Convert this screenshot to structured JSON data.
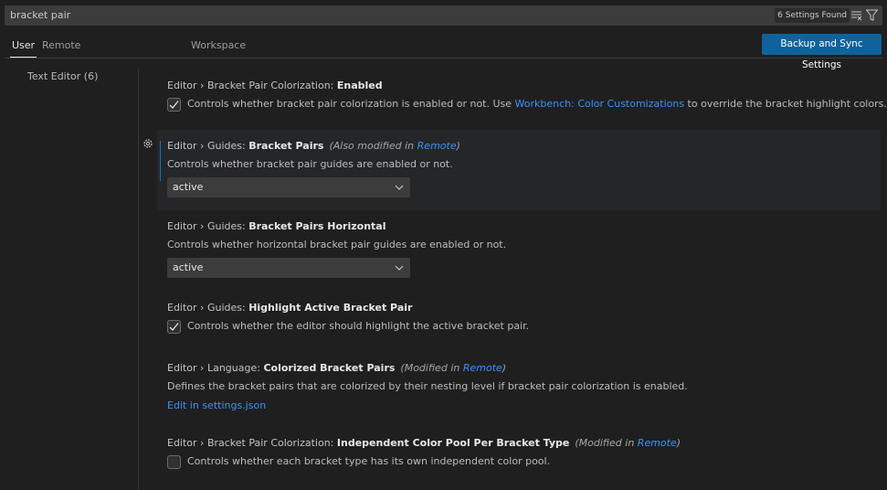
{
  "search": {
    "value": "bracket pair",
    "results_count": "6 Settings Found",
    "clear_icon": "clear-filter-icon",
    "filter_icon": "filter-icon"
  },
  "tabs": [
    {
      "label": "User",
      "active": true
    },
    {
      "label": "Remote",
      "active": false
    },
    {
      "label": "Workspace",
      "active": false
    }
  ],
  "sync_button": "Backup and Sync Settings",
  "toc": {
    "items": [
      {
        "label": "Text Editor (6)"
      }
    ]
  },
  "settings": [
    {
      "category": "Editor › Bracket Pair Colorization: ",
      "name": "Enabled",
      "control": "checkbox",
      "checked": true,
      "desc_before": "Controls whether bracket pair colorization is enabled or not. Use ",
      "desc_link": "Workbench: Color Customizations",
      "desc_after": " to override the bracket highlight colors."
    },
    {
      "category": "Editor › Guides: ",
      "name": "Bracket Pairs",
      "modified_prefix": "(Also modified in ",
      "modified_link": "Remote",
      "modified_suffix": ")",
      "description": "Controls whether bracket pair guides are enabled or not.",
      "control": "select",
      "value": "active"
    },
    {
      "category": "Editor › Guides: ",
      "name": "Bracket Pairs Horizontal",
      "description": "Controls whether horizontal bracket pair guides are enabled or not.",
      "control": "select",
      "value": "active"
    },
    {
      "category": "Editor › Guides: ",
      "name": "Highlight Active Bracket Pair",
      "control": "checkbox",
      "checked": true,
      "description": "Controls whether the editor should highlight the active bracket pair."
    },
    {
      "category": "Editor › Language: ",
      "name": "Colorized Bracket Pairs",
      "modified_prefix": "(Modified in ",
      "modified_link": "Remote",
      "modified_suffix": ")",
      "description": "Defines the bracket pairs that are colorized by their nesting level if bracket pair colorization is enabled.",
      "edit_link": "Edit in settings.json"
    },
    {
      "category": "Editor › Bracket Pair Colorization: ",
      "name": "Independent Color Pool Per Bracket Type",
      "modified_prefix": "(Modified in ",
      "modified_link": "Remote",
      "modified_suffix": ")",
      "control": "checkbox",
      "checked": false,
      "description": "Controls whether each bracket type has its own independent color pool."
    }
  ],
  "colors": {
    "accent": "#0e639c",
    "link": "#3794ff",
    "focus_bar": "#0078d4",
    "background": "#1f1f1f"
  }
}
